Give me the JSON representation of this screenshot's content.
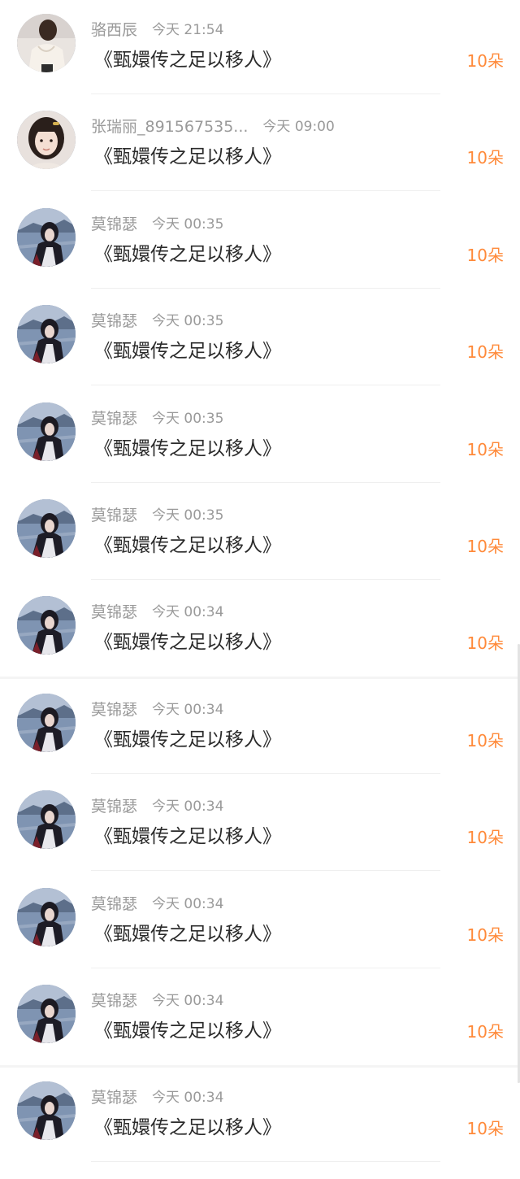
{
  "records": [
    {
      "name": "骆西辰",
      "time": "今天 21:54",
      "title": "《甄嬛传之足以移人》",
      "gift": "10朵",
      "avatar": "avatar-light-blouse"
    },
    {
      "name": "张瑞丽_891567535...",
      "time": "今天 09:00",
      "title": "《甄嬛传之足以移人》",
      "gift": "10朵",
      "avatar": "avatar-girl-hairclip"
    },
    {
      "name": "莫锦瑟",
      "time": "今天 00:35",
      "title": "《甄嬛传之足以移人》",
      "gift": "10朵",
      "avatar": "avatar-lakeside"
    },
    {
      "name": "莫锦瑟",
      "time": "今天 00:35",
      "title": "《甄嬛传之足以移人》",
      "gift": "10朵",
      "avatar": "avatar-lakeside"
    },
    {
      "name": "莫锦瑟",
      "time": "今天 00:35",
      "title": "《甄嬛传之足以移人》",
      "gift": "10朵",
      "avatar": "avatar-lakeside"
    },
    {
      "name": "莫锦瑟",
      "time": "今天 00:35",
      "title": "《甄嬛传之足以移人》",
      "gift": "10朵",
      "avatar": "avatar-lakeside"
    },
    {
      "name": "莫锦瑟",
      "time": "今天 00:34",
      "title": "《甄嬛传之足以移人》",
      "gift": "10朵",
      "avatar": "avatar-lakeside"
    },
    {
      "name": "莫锦瑟",
      "time": "今天 00:34",
      "title": "《甄嬛传之足以移人》",
      "gift": "10朵",
      "avatar": "avatar-lakeside"
    },
    {
      "name": "莫锦瑟",
      "time": "今天 00:34",
      "title": "《甄嬛传之足以移人》",
      "gift": "10朵",
      "avatar": "avatar-lakeside"
    },
    {
      "name": "莫锦瑟",
      "time": "今天 00:34",
      "title": "《甄嬛传之足以移人》",
      "gift": "10朵",
      "avatar": "avatar-lakeside"
    },
    {
      "name": "莫锦瑟",
      "time": "今天 00:34",
      "title": "《甄嬛传之足以移人》",
      "gift": "10朵",
      "avatar": "avatar-lakeside"
    },
    {
      "name": "莫锦瑟",
      "time": "今天 00:34",
      "title": "《甄嬛传之足以移人》",
      "gift": "10朵",
      "avatar": "avatar-lakeside"
    }
  ],
  "colors": {
    "gift": "#ff8a3a",
    "meta": "#9a9a9a",
    "title": "#2b2b2b"
  }
}
